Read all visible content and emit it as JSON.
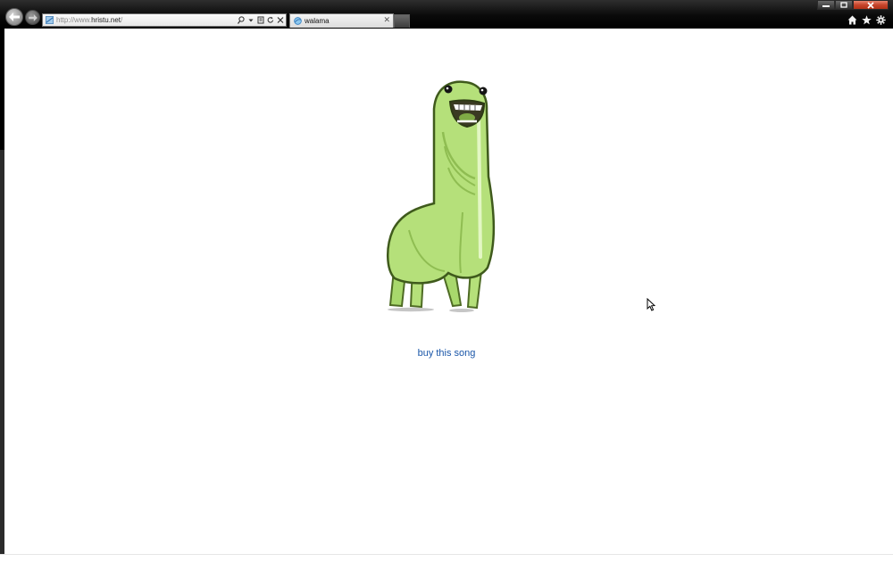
{
  "browser": {
    "address_bar": {
      "url_prefix": "http://www.",
      "url_domain": "hristu.net",
      "url_suffix": "/"
    },
    "tabs": [
      {
        "title": "walama",
        "active": true
      }
    ],
    "address_tools": [
      "search-icon",
      "dropdown-icon",
      "compatibility-icon",
      "refresh-icon",
      "stop-icon"
    ],
    "caption_buttons": [
      "minimize",
      "maximize",
      "close"
    ],
    "command_icons": [
      "home-icon",
      "favorites-icon",
      "tools-icon"
    ],
    "colors": {
      "frame": "#000000",
      "link": "#1a56a8",
      "close_button": "#c6452c",
      "creature_green": "#b5e07a"
    }
  },
  "page": {
    "buy_link_label": "buy this song"
  }
}
